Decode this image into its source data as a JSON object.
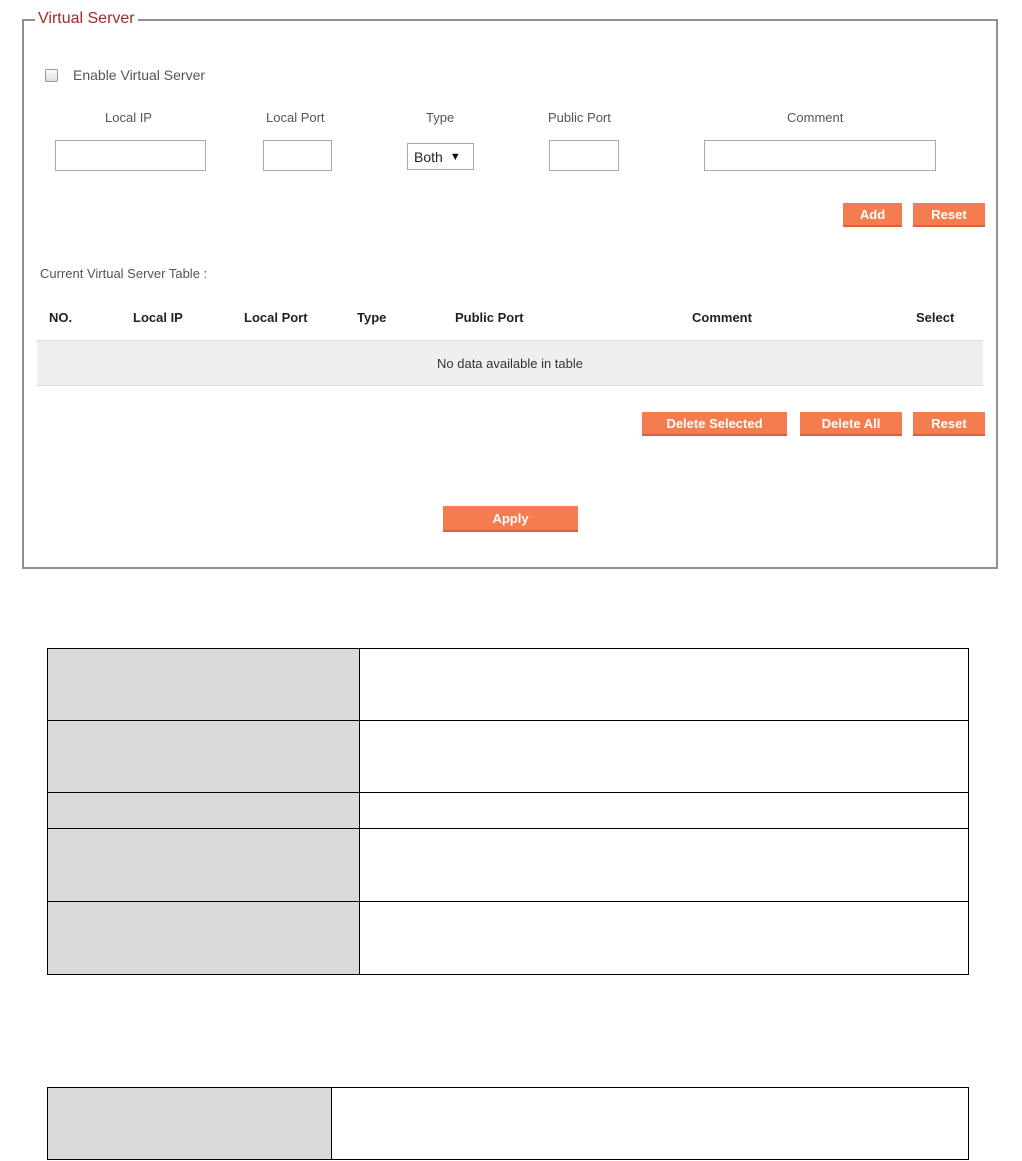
{
  "panel": {
    "legend": "Virtual Server",
    "enable_label": "Enable Virtual Server",
    "enable_checked": false
  },
  "form": {
    "columns": {
      "local_ip": "Local IP",
      "local_port": "Local Port",
      "type": "Type",
      "public_port": "Public Port",
      "comment": "Comment"
    },
    "values": {
      "local_ip": "",
      "local_port": "",
      "type": "Both",
      "public_port": "",
      "comment": ""
    },
    "buttons": {
      "add": "Add",
      "reset": "Reset"
    }
  },
  "table": {
    "caption": "Current Virtual Server Table :",
    "headers": {
      "no": "NO.",
      "local_ip": "Local IP",
      "local_port": "Local Port",
      "type": "Type",
      "public_port": "Public Port",
      "comment": "Comment",
      "select": "Select"
    },
    "empty_text": "No data available in table",
    "buttons": {
      "delete_selected": "Delete Selected",
      "delete_all": "Delete All",
      "reset": "Reset"
    }
  },
  "apply_label": "Apply",
  "colors": {
    "button": "#f47c4f",
    "legend": "#a52a2a",
    "table_row": "#efefef",
    "key_cell": "#d9d9d9"
  }
}
